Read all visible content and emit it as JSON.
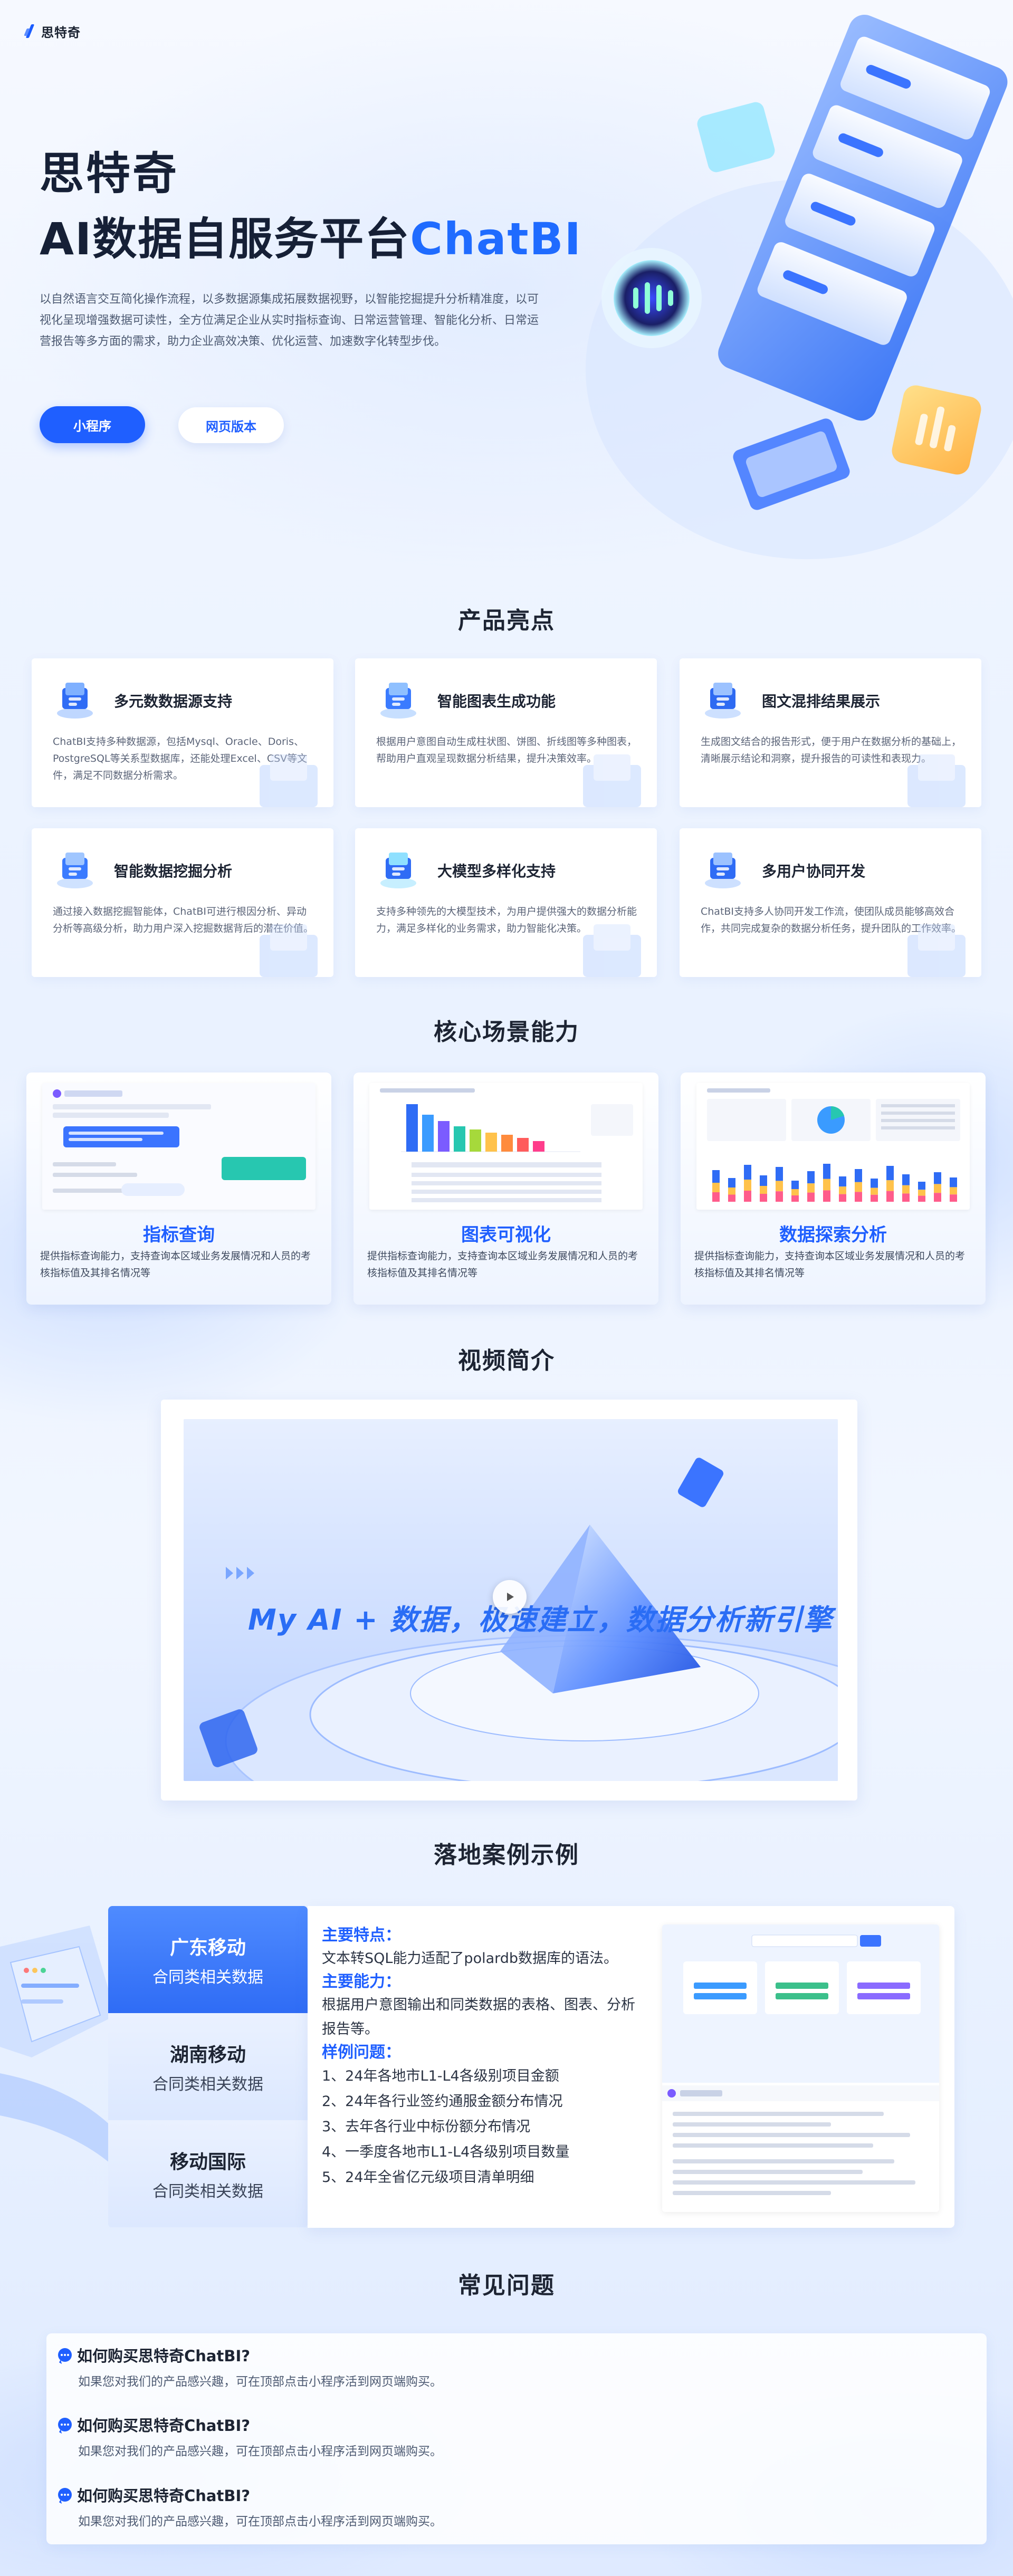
{
  "header": {
    "logo_text": "思特奇"
  },
  "hero": {
    "title_line1": "思特奇",
    "title_line2_main": "AI数据自服务平台",
    "title_line2_accent": "ChatBI",
    "description": "以自然语言交互简化操作流程，以多数据源集成拓展数据视野，以智能挖掘提升分析精准度，以可视化呈现增强数据可读性，全方位满足企业从实时指标查询、日常运营管理、智能化分析、日常运营报告等多方面的需求，助力企业高效决策、优化运营、加速数字化转型步伐。",
    "buttons": {
      "primary": "小程序",
      "secondary": "网页版本"
    }
  },
  "highlights": {
    "title": "产品亮点",
    "items": [
      {
        "title": "多元数数据源支持",
        "desc": "ChatBI支持多种数据源，包括Mysql、Oracle、Doris、PostgreSQL等关系型数据库，还能处理Excel、CSV等文件，满足不同数据分析需求。"
      },
      {
        "title": "智能图表生成功能",
        "desc": "根据用户意图自动生成柱状图、饼图、折线图等多种图表，帮助用户直观呈现数据分析结果，提升决策效率。"
      },
      {
        "title": "图文混排结果展示",
        "desc": "生成图文结合的报告形式，便于用户在数据分析的基础上，清晰展示结论和洞察，提升报告的可读性和表现力。"
      },
      {
        "title": "智能数据挖掘分析",
        "desc": "通过接入数据挖掘智能体，ChatBI可进行根因分析、异动分析等高级分析，助力用户深入挖掘数据背后的潜在价值。"
      },
      {
        "title": "大模型多样化支持",
        "desc": "支持多种领先的大模型技术，为用户提供强大的数据分析能力，满足多样化的业务需求，助力智能化决策。"
      },
      {
        "title": "多用户协同开发",
        "desc": "ChatBI支持多人协同开发工作流，使团队成员能够高效合作，共同完成复杂的数据分析任务，提升团队的工作效率。"
      }
    ]
  },
  "scenes": {
    "title": "核心场景能力",
    "items": [
      {
        "title": "指标查询",
        "desc": "提供指标查询能力，支持查询本区域业务发展情况和人员的考核指标值及其排名情况等"
      },
      {
        "title": "图表可视化",
        "desc": "提供指标查询能力，支持查询本区域业务发展情况和人员的考核指标值及其排名情况等"
      },
      {
        "title": "数据探索分析",
        "desc": "提供指标查询能力，支持查询本区域业务发展情况和人员的考核指标值及其排名情况等"
      }
    ]
  },
  "video": {
    "title": "视频简介",
    "overlay_text": "My AI + 数据，极速建立，数据分析新引擎"
  },
  "cases": {
    "title": "落地案例示例",
    "tabs": [
      {
        "name": "广东移动",
        "sub": "合同类相关数据"
      },
      {
        "name": "湖南移动",
        "sub": "合同类相关数据"
      },
      {
        "name": "移动国际",
        "sub": "合同类相关数据"
      }
    ],
    "active": {
      "features_label": "主要特点：",
      "features_text": "文本转SQL能力适配了polardb数据库的语法。",
      "abilities_label": "主要能力：",
      "abilities_text": "根据用户意图输出和同类数据的表格、图表、分析报告等。",
      "examples_label": "样例问题：",
      "examples": [
        "1、24年各地市L1-L4各级别项目金额",
        "2、24年各行业签约通服金额分布情况",
        "3、去年各行业中标份额分布情况",
        "4、一季度各地市L1-L4各级别项目数量",
        "5、24年全省亿元级项目清单明细"
      ]
    }
  },
  "faq": {
    "title": "常见问题",
    "items": [
      {
        "q": "如何购买思特奇ChatBI?",
        "a": "如果您对我们的产品感兴趣，可在顶部点击小程序活到网页端购买。"
      },
      {
        "q": "如何购买思特奇ChatBI?",
        "a": "如果您对我们的产品感兴趣，可在顶部点击小程序活到网页端购买。"
      },
      {
        "q": "如何购买思特奇ChatBI?",
        "a": "如果您对我们的产品感兴趣，可在顶部点击小程序活到网页端购买。"
      }
    ]
  },
  "colors": {
    "brand": "#1f5fff",
    "accent_text": "#1f6bff",
    "title": "#1d2433"
  }
}
